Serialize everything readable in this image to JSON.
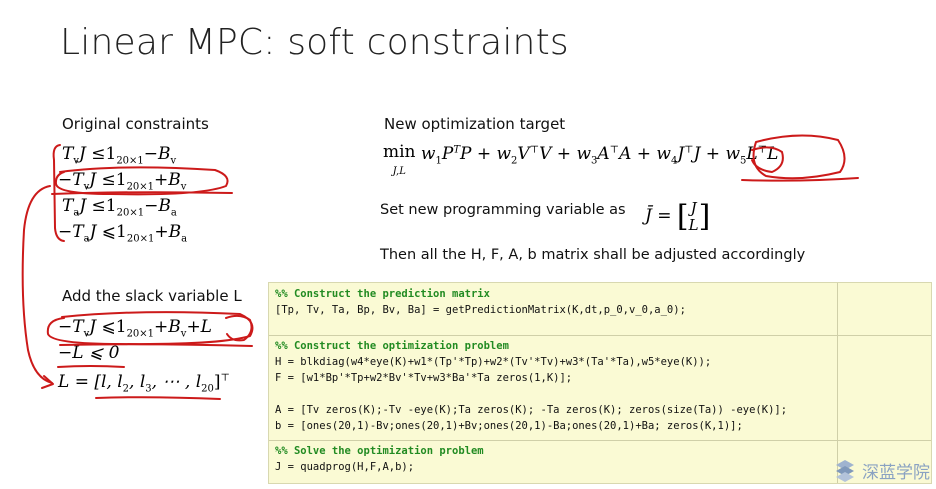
{
  "title": "Linear MPC: soft constraints",
  "original": {
    "label": "Original constraints",
    "rows": [
      {
        "lhs": "T",
        "lhs_sub": "v",
        "lhs_var": "J",
        "op": "≤",
        "rhs_one": "1",
        "rhs_sub": "20×1",
        "rhs_rest": "−B",
        "rhs_rest_sub": "v",
        "neg": false
      },
      {
        "lhs": "T",
        "lhs_sub": "v",
        "lhs_var": "J",
        "op": "≤",
        "rhs_one": "1",
        "rhs_sub": "20×1",
        "rhs_rest": "+B",
        "rhs_rest_sub": "v",
        "neg": true
      },
      {
        "lhs": "T",
        "lhs_sub": "a",
        "lhs_var": "J",
        "op": "≤",
        "rhs_one": "1",
        "rhs_sub": "20×1",
        "rhs_rest": "−B",
        "rhs_rest_sub": "a",
        "neg": false
      },
      {
        "lhs": "T",
        "lhs_sub": "a",
        "lhs_var": "J",
        "op": "⩽",
        "rhs_one": "1",
        "rhs_sub": "20×1",
        "rhs_rest": "+B",
        "rhs_rest_sub": "a",
        "neg": true
      }
    ]
  },
  "slack": {
    "label": "Add the slack variable L",
    "eq1": "−T",
    "eq1_sub": "v",
    "eq1_var": "J",
    "eq1_op": "⩽",
    "eq1_one": "1",
    "eq1_one_sub": "20×1",
    "eq1_rest": "+B",
    "eq1_rest_sub": "v",
    "eq1_tail": "+L",
    "eq2": "−L ⩽ 0",
    "eq3_lhs": "L",
    "eq3_body": " = [l, l",
    "eq3_s2": "2",
    "eq3_mid": ", l",
    "eq3_s3": "3",
    "eq3_dots": ", ⋯ , l",
    "eq3_s20": "20",
    "eq3_close": "]",
    "eq3_sup": "⊤"
  },
  "target": {
    "label": "New optimization target",
    "min": "min",
    "min_sub": "J,L",
    "w1": "w",
    "w1s": "1",
    "p1": "P",
    "p1sup": "T",
    "p2": "P",
    "w2": "+ w",
    "w2s": "2",
    "v1": "V",
    "v1sup": "⊤",
    "v2": "V",
    "w3": "+ w",
    "w3s": "3",
    "a1": "A",
    "a1sup": "⊤",
    "a2": "A",
    "w4": "+ w",
    "w4s": "4",
    "j1": "J",
    "j1sup": "⊤",
    "j2": "J",
    "w5": "+ w",
    "w5s": "5",
    "l1": "L",
    "l1sup": "⊤",
    "l2": "L"
  },
  "set_var": {
    "text": "Set new programming variable as",
    "var": "J̄ =",
    "top": "J",
    "bottom": "L"
  },
  "then_text": "Then all the H, F, A, b matrix shall be adjusted accordingly",
  "code": {
    "lines": [
      {
        "text": "%% Construct the prediction matrix",
        "comment": true
      },
      {
        "text": "[Tp, Tv, Ta, Bp, Bv, Ba] = getPredictionMatrix(K,dt,p_0,v_0,a_0);",
        "comment": false
      },
      {
        "text": "%% Construct the optimization problem",
        "comment": true
      },
      {
        "text": "H = blkdiag(w4*eye(K)+w1*(Tp'*Tp)+w2*(Tv'*Tv)+w3*(Ta'*Ta),w5*eye(K));",
        "comment": false
      },
      {
        "text": "F = [w1*Bp'*Tp+w2*Bv'*Tv+w3*Ba'*Ta zeros(1,K)];",
        "comment": false
      },
      {
        "text": "",
        "comment": false
      },
      {
        "text": "A = [Tv zeros(K);-Tv -eye(K);Ta zeros(K); -Ta zeros(K); zeros(size(Ta)) -eye(K)];",
        "comment": false
      },
      {
        "text": "b = [ones(20,1)-Bv;ones(20,1)+Bv;ones(20,1)-Ba;ones(20,1)+Ba; zeros(K,1)];",
        "comment": false
      },
      {
        "text": "%% Solve the optimization problem",
        "comment": true
      },
      {
        "text": "J = quadprog(H,F,A,b);",
        "comment": false
      }
    ]
  },
  "logo": {
    "text": "深蓝学院",
    "icon": "logo-s-icon"
  },
  "colors": {
    "annotation": "#cc1a1a",
    "code_bg": "#fafad4",
    "comment": "#228b22",
    "logo": "#8aa2c2"
  }
}
